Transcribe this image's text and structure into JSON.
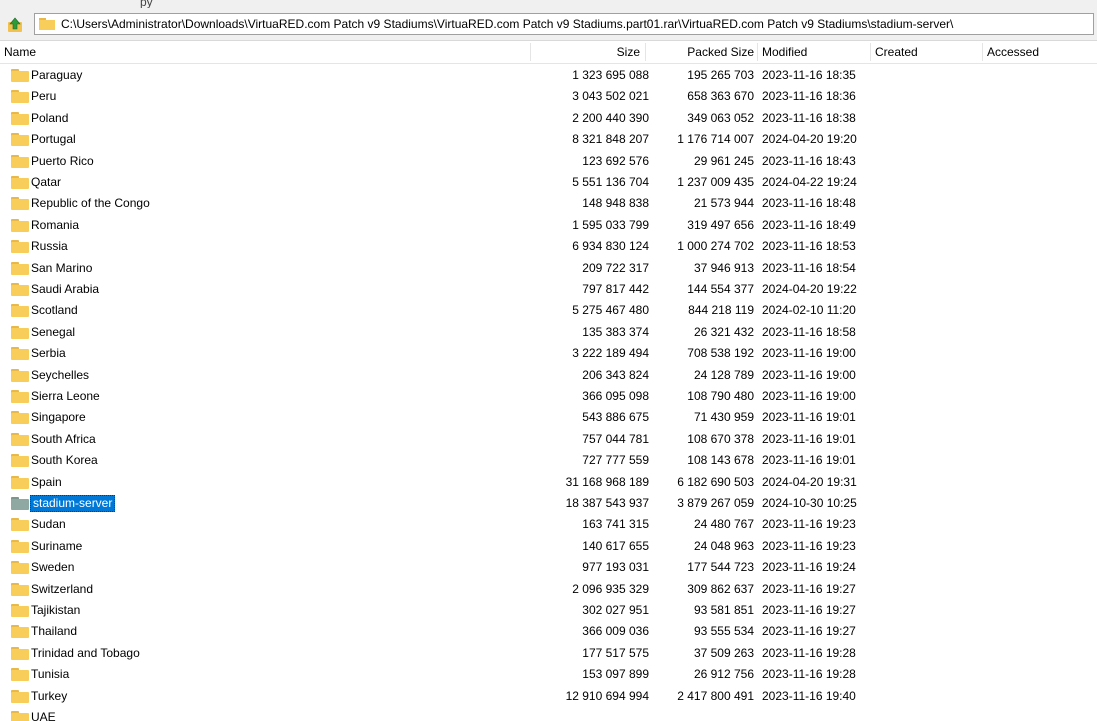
{
  "topstrip_fragment": "py",
  "address": {
    "path": "C:\\Users\\Administrator\\Downloads\\VirtuaRED.com Patch v9 Stadiums\\VirtuaRED.com Patch v9 Stadiums.part01.rar\\VirtuaRED.com Patch v9 Stadiums\\stadium-server\\"
  },
  "columns": {
    "name": "Name",
    "size": "Size",
    "packed": "Packed Size",
    "modified": "Modified",
    "created": "Created",
    "accessed": "Accessed"
  },
  "colors": {
    "folder": "#f8cd5a",
    "folder_selected": "#8fa8a1",
    "selection": "#0078d7"
  },
  "selected_row": 20,
  "rows": [
    {
      "name": "Paraguay",
      "size": "1 323 695 088",
      "packed": "195 265 703",
      "modified": "2023-11-16 18:35"
    },
    {
      "name": "Peru",
      "size": "3 043 502 021",
      "packed": "658 363 670",
      "modified": "2023-11-16 18:36"
    },
    {
      "name": "Poland",
      "size": "2 200 440 390",
      "packed": "349 063 052",
      "modified": "2023-11-16 18:38"
    },
    {
      "name": "Portugal",
      "size": "8 321 848 207",
      "packed": "1 176 714 007",
      "modified": "2024-04-20 19:20"
    },
    {
      "name": "Puerto Rico",
      "size": "123 692 576",
      "packed": "29 961 245",
      "modified": "2023-11-16 18:43"
    },
    {
      "name": "Qatar",
      "size": "5 551 136 704",
      "packed": "1 237 009 435",
      "modified": "2024-04-22 19:24"
    },
    {
      "name": "Republic of the Congo",
      "size": "148 948 838",
      "packed": "21 573 944",
      "modified": "2023-11-16 18:48"
    },
    {
      "name": "Romania",
      "size": "1 595 033 799",
      "packed": "319 497 656",
      "modified": "2023-11-16 18:49"
    },
    {
      "name": "Russia",
      "size": "6 934 830 124",
      "packed": "1 000 274 702",
      "modified": "2023-11-16 18:53"
    },
    {
      "name": "San Marino",
      "size": "209 722 317",
      "packed": "37 946 913",
      "modified": "2023-11-16 18:54"
    },
    {
      "name": "Saudi Arabia",
      "size": "797 817 442",
      "packed": "144 554 377",
      "modified": "2024-04-20 19:22"
    },
    {
      "name": "Scotland",
      "size": "5 275 467 480",
      "packed": "844 218 119",
      "modified": "2024-02-10 11:20"
    },
    {
      "name": "Senegal",
      "size": "135 383 374",
      "packed": "26 321 432",
      "modified": "2023-11-16 18:58"
    },
    {
      "name": "Serbia",
      "size": "3 222 189 494",
      "packed": "708 538 192",
      "modified": "2023-11-16 19:00"
    },
    {
      "name": "Seychelles",
      "size": "206 343 824",
      "packed": "24 128 789",
      "modified": "2023-11-16 19:00"
    },
    {
      "name": "Sierra Leone",
      "size": "366 095 098",
      "packed": "108 790 480",
      "modified": "2023-11-16 19:00"
    },
    {
      "name": "Singapore",
      "size": "543 886 675",
      "packed": "71 430 959",
      "modified": "2023-11-16 19:01"
    },
    {
      "name": "South Africa",
      "size": "757 044 781",
      "packed": "108 670 378",
      "modified": "2023-11-16 19:01"
    },
    {
      "name": "South Korea",
      "size": "727 777 559",
      "packed": "108 143 678",
      "modified": "2023-11-16 19:01"
    },
    {
      "name": "Spain",
      "size": "31 168 968 189",
      "packed": "6 182 690 503",
      "modified": "2024-04-20 19:31"
    },
    {
      "name": "stadium-server",
      "size": "18 387 543 937",
      "packed": "3 879 267 059",
      "modified": "2024-10-30 10:25"
    },
    {
      "name": "Sudan",
      "size": "163 741 315",
      "packed": "24 480 767",
      "modified": "2023-11-16 19:23"
    },
    {
      "name": "Suriname",
      "size": "140 617 655",
      "packed": "24 048 963",
      "modified": "2023-11-16 19:23"
    },
    {
      "name": "Sweden",
      "size": "977 193 031",
      "packed": "177 544 723",
      "modified": "2023-11-16 19:24"
    },
    {
      "name": "Switzerland",
      "size": "2 096 935 329",
      "packed": "309 862 637",
      "modified": "2023-11-16 19:27"
    },
    {
      "name": "Tajikistan",
      "size": "302 027 951",
      "packed": "93 581 851",
      "modified": "2023-11-16 19:27"
    },
    {
      "name": "Thailand",
      "size": "366 009 036",
      "packed": "93 555 534",
      "modified": "2023-11-16 19:27"
    },
    {
      "name": "Trinidad and Tobago",
      "size": "177 517 575",
      "packed": "37 509 263",
      "modified": "2023-11-16 19:28"
    },
    {
      "name": "Tunisia",
      "size": "153 097 899",
      "packed": "26 912 756",
      "modified": "2023-11-16 19:28"
    },
    {
      "name": "Turkey",
      "size": "12 910 694 994",
      "packed": "2 417 800 491",
      "modified": "2023-11-16 19:40"
    },
    {
      "name": "UAE",
      "size": "",
      "packed": "",
      "modified": ""
    }
  ]
}
